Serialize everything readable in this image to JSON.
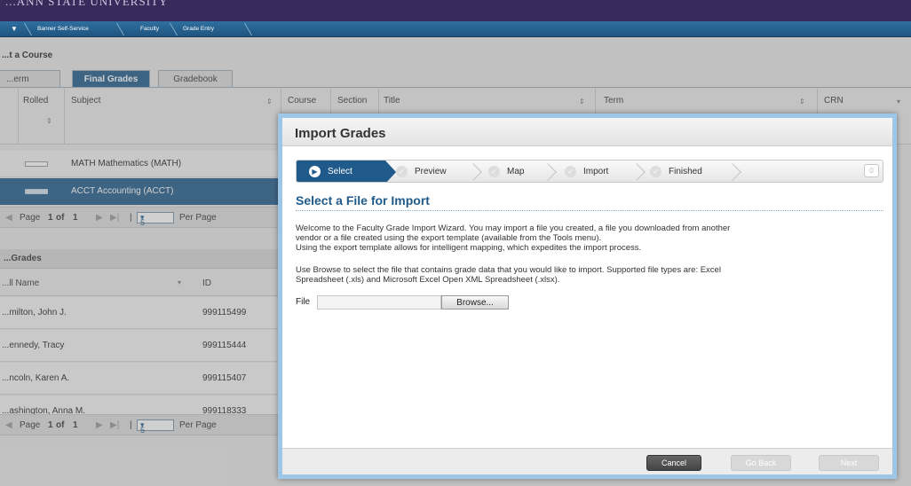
{
  "header": {
    "brand": "...ANN STATE UNIVERSITY",
    "breadcrumbs": [
      "Banner Self-Service",
      "Faculty",
      "Grade Entry"
    ]
  },
  "background": {
    "title": "...t a Course",
    "tabs": [
      {
        "label": "...erm Grades",
        "active": false
      },
      {
        "label": "Final Grades",
        "active": true
      },
      {
        "label": "Gradebook",
        "active": false
      }
    ],
    "course_table": {
      "headers": {
        "rolled": "Rolled",
        "subject": "Subject",
        "course": "Course",
        "section": "Section",
        "title": "Title",
        "term": "Term",
        "crn": "CRN"
      },
      "rows": [
        {
          "subject": "MATH Mathematics (MATH)",
          "selected": false
        },
        {
          "subject": "ACCT Accounting (ACCT)",
          "selected": true
        }
      ],
      "pager": {
        "page_label": "Page",
        "page": "1",
        "of_label": "of",
        "total": "1",
        "per_page_value": "5",
        "per_page_label": "Per Page"
      }
    },
    "grades_section": {
      "title": "...Grades",
      "headers": {
        "name": "...ll Name",
        "id": "ID"
      },
      "rows": [
        {
          "name": "...milton, John J.",
          "id": "999115499"
        },
        {
          "name": "...ennedy, Tracy",
          "id": "999115444"
        },
        {
          "name": "...ncoln, Karen A.",
          "id": "999115407"
        },
        {
          "name": "...ashington, Anna M.",
          "id": "999118333"
        }
      ],
      "pager": {
        "page_label": "Page",
        "page": "1",
        "of_label": "of",
        "total": "1",
        "per_page_value": "5",
        "per_page_label": "Per Page"
      }
    }
  },
  "modal": {
    "title": "Import Grades",
    "steps": [
      {
        "label": "Select",
        "active": true
      },
      {
        "label": "Preview",
        "active": false
      },
      {
        "label": "Map",
        "active": false
      },
      {
        "label": "Import",
        "active": false
      },
      {
        "label": "Finished",
        "active": false
      }
    ],
    "step_count": "0",
    "heading": "Select a File for Import",
    "para1_line1": "Welcome to the Faculty Grade Import Wizard. You may import a file you created, a file you downloaded from another",
    "para1_line2": "vendor or a file created using the export template (available from the Tools menu).",
    "para1_line3": "Using the export template allows for intelligent mapping, which expedites the import process.",
    "para2_line1": "Use Browse to select the file that contains grade data that you would like to import. Supported file types are: Excel",
    "para2_line2": "Spreadsheet (.xls) and Microsoft Excel Open XML Spreadsheet (.xlsx).",
    "file_label": "File",
    "file_value": "",
    "browse_label": "Browse...",
    "buttons": {
      "cancel": "Cancel",
      "back": "Go Back",
      "next": "Next"
    }
  }
}
